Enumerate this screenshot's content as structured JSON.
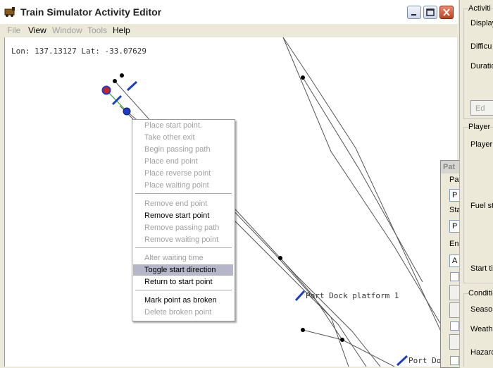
{
  "window": {
    "title": "Train Simulator Activity Editor",
    "buttons": {
      "minimize": "_",
      "maximize": "□",
      "close": "✕"
    }
  },
  "menu": [
    {
      "label": "File",
      "enabled": false
    },
    {
      "label": "View",
      "enabled": true
    },
    {
      "label": "Window",
      "enabled": false
    },
    {
      "label": "Tools",
      "enabled": false
    },
    {
      "label": "Help",
      "enabled": true
    }
  ],
  "map": {
    "coordinates": "Lon: 137.13127 Lat: -33.07629",
    "labels": [
      "Port Dock platform 1",
      "Port Do"
    ]
  },
  "context_menu": {
    "items": [
      {
        "label": "Place start point.",
        "enabled": false
      },
      {
        "label": "Take other exit",
        "enabled": false
      },
      {
        "label": "Begin passing path",
        "enabled": false
      },
      {
        "label": "Place end point",
        "enabled": false
      },
      {
        "label": "Place reverse point",
        "enabled": false
      },
      {
        "label": "Place waiting point",
        "enabled": false
      },
      {
        "label": "Remove end point",
        "enabled": false
      },
      {
        "label": "Remove start point",
        "enabled": true
      },
      {
        "label": "Remove passing path",
        "enabled": false
      },
      {
        "label": "Remove waiting point",
        "enabled": false
      },
      {
        "label": "Alter waiting time",
        "enabled": false
      },
      {
        "label": "Toggle start direction",
        "enabled": true,
        "highlighted": true
      },
      {
        "label": "Return to start point",
        "enabled": true
      },
      {
        "label": "Mark point as broken",
        "enabled": true
      },
      {
        "label": "Delete broken point",
        "enabled": false
      }
    ]
  },
  "right_panel": {
    "activity_group": "Activiti",
    "display": "Display",
    "difficulty": "Difficu",
    "duration": "Duratio",
    "edit_button": "Ed",
    "player_group": "Player",
    "player": "Player",
    "fuel": "Fuel sta",
    "start": "Start ti",
    "conditions_group": "Conditi",
    "season": "Season:",
    "weather": "Weathe",
    "hazard": "Hazard"
  },
  "path_dialog": {
    "title": "Pat",
    "path_label": "Pa",
    "path_value": "P",
    "start_label": "Sta",
    "start_value": "P",
    "end_label": "En",
    "end_value": "A"
  },
  "colors": {
    "start_marker_fill": "#cc2222",
    "node_blue": "#1a3dcc",
    "track": "#555555",
    "menu_highlight": "#b6b6c8"
  }
}
